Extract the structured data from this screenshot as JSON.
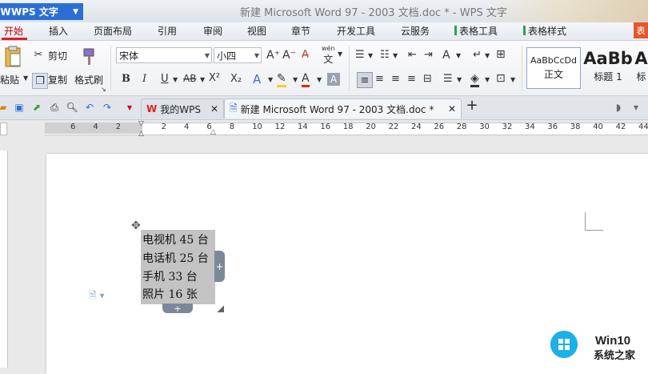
{
  "app": {
    "name": "WPS 文字",
    "window_title": "新建 Microsoft Word 97 - 2003 文档.doc * - WPS 文字"
  },
  "menu": {
    "tabs": [
      "开始",
      "插入",
      "页面布局",
      "引用",
      "审阅",
      "视图",
      "章节",
      "开发工具",
      "云服务",
      "表格工具",
      "表格样式"
    ],
    "corner": "表"
  },
  "ribbon": {
    "paste": "粘贴",
    "cut": "剪切",
    "copy": "复制",
    "format_painter": "格式刷",
    "font_name": "宋体",
    "font_size": "小四",
    "pinyin": "wén",
    "styles": [
      {
        "sample": "AaBbCcDd",
        "name": "正文"
      },
      {
        "sample": "AaBb",
        "name": "标题 1"
      },
      {
        "sample": "A",
        "name": "标"
      }
    ]
  },
  "tabs": {
    "home_tab": "我的WPS",
    "doc_tab": "新建 Microsoft Word 97 - 2003 文档.doc *",
    "new_tab": "+"
  },
  "ruler": {
    "numbers": [
      "6",
      "4",
      "2",
      "",
      "2",
      "4",
      "6",
      "8",
      "10",
      "12",
      "14",
      "16",
      "18",
      "20",
      "22",
      "24",
      "26",
      "28",
      "30",
      "32",
      "34",
      "36",
      "38",
      "40",
      "42",
      "44"
    ]
  },
  "document": {
    "lines": [
      "电视机 45 台",
      "电话机 25 台",
      "手机 33 台",
      "照片 16 张"
    ]
  },
  "watermark": {
    "line1": "Win10",
    "line2": "系统之家"
  },
  "colors": {
    "accent_red": "#d22222",
    "app_blue": "#2b6fd6",
    "selection_grey": "#c3c3c3",
    "handle_grey": "#7a8899"
  }
}
